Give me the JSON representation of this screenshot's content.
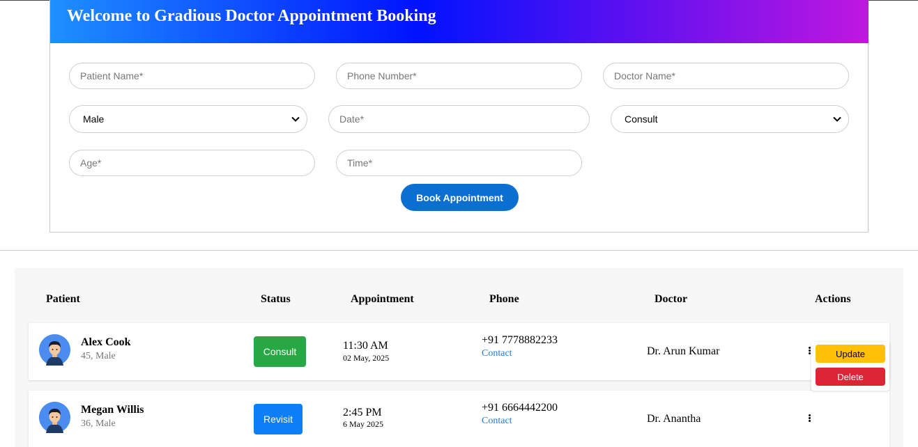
{
  "form": {
    "title": "Welcome to Gradious Doctor Appointment Booking",
    "patient_name_placeholder": "Patient Name*",
    "phone_placeholder": "Phone Number*",
    "doctor_placeholder": "Doctor Name*",
    "gender_value": "Male",
    "date_placeholder": "Date*",
    "type_value": "Consult",
    "age_placeholder": "Age*",
    "time_placeholder": "Time*",
    "book_label": "Book Appointment"
  },
  "table": {
    "headers": [
      "Patient",
      "Status",
      "Appointment",
      "Phone",
      "Doctor",
      "Actions"
    ],
    "rows": [
      {
        "name": "Alex Cook",
        "meta": "45, Male",
        "status": "Consult",
        "status_color": "#28a745",
        "time": "11:30 AM",
        "date": "02 May, 2025",
        "phone": "+91 7778882233",
        "contact": "Contact",
        "doctor": "Dr. Arun Kumar"
      },
      {
        "name": "Megan Willis",
        "meta": "36, Male",
        "status": "Revisit",
        "status_color": "#0d7ef5",
        "time": "2:45 PM",
        "date": "6 May 2025",
        "phone": "+91 6664442200",
        "contact": "Contact",
        "doctor": "Dr. Anantha"
      }
    ]
  },
  "actions_menu": {
    "update_label": "Update",
    "update_color": "#ffc107",
    "delete_label": "Delete",
    "delete_color": "#dc2535"
  },
  "icons": {
    "avatar": "user-avatar-icon",
    "chevron": "chevron-down-icon",
    "kebab": "kebab-menu-icon"
  }
}
